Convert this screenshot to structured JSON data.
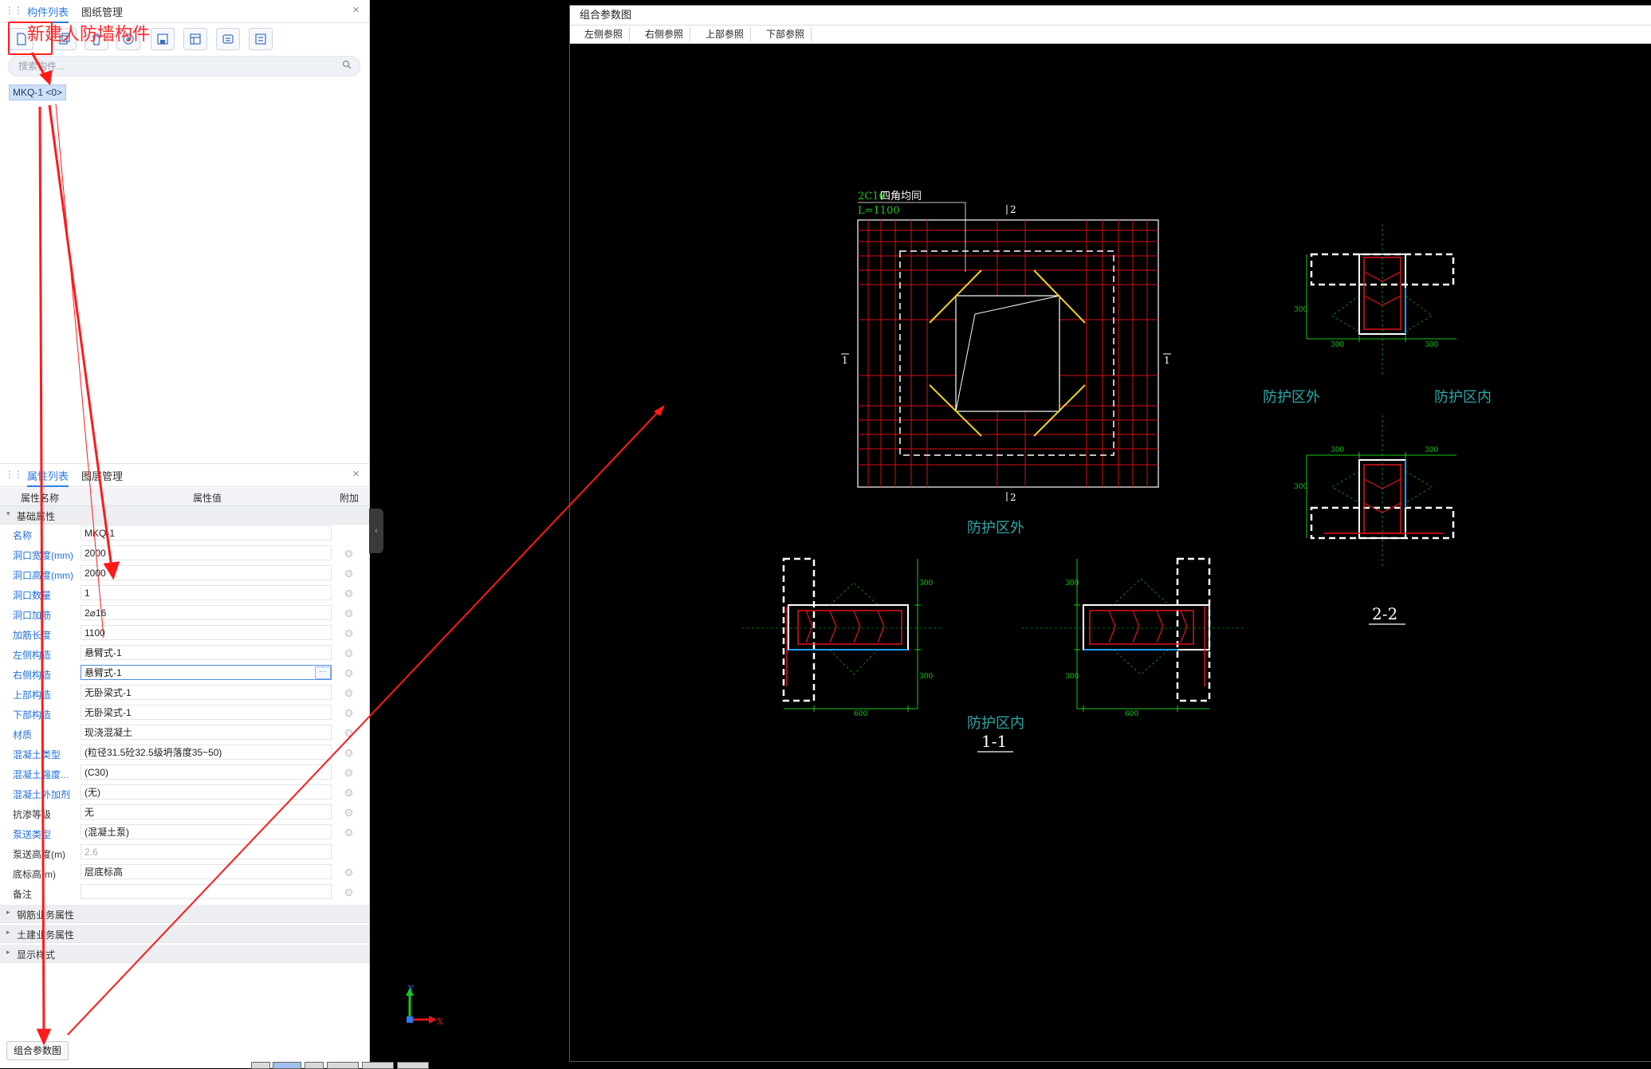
{
  "top_tabs": {
    "tab1": "构件列表",
    "tab2": "图纸管理",
    "close": "×"
  },
  "annotation": {
    "text": "新建人防墙构件"
  },
  "search": {
    "placeholder": "搜索构件..."
  },
  "tree": {
    "item": "MKQ-1 <0>"
  },
  "prop_tabs": {
    "tab1": "属性列表",
    "tab2": "图层管理",
    "close": "×"
  },
  "prop_header": {
    "name": "属性名称",
    "value": "属性值",
    "extra": "附加"
  },
  "groups": {
    "basic": "基础属性",
    "rebar": "钢筋业务属性",
    "civil": "土建业务属性",
    "display": "显示样式"
  },
  "properties": [
    {
      "name": "名称",
      "value": "MKQ-1",
      "blue": true
    },
    {
      "name": "洞口宽度(mm)",
      "value": "2000",
      "blue": true
    },
    {
      "name": "洞口高度(mm)",
      "value": "2000",
      "blue": true
    },
    {
      "name": "洞口数量",
      "value": "1",
      "blue": true
    },
    {
      "name": "洞口加筋",
      "value": "2⌀16",
      "blue": true
    },
    {
      "name": "加筋长度",
      "value": "1100",
      "blue": true
    },
    {
      "name": "左侧构造",
      "value": "悬臂式-1",
      "blue": true
    },
    {
      "name": "右侧构造",
      "value": "悬臂式-1",
      "blue": true
    },
    {
      "name": "上部构造",
      "value": "无卧梁式-1",
      "blue": true
    },
    {
      "name": "下部构造",
      "value": "无卧梁式-1",
      "blue": true
    },
    {
      "name": "材质",
      "value": "现浇混凝土",
      "blue": true
    },
    {
      "name": "混凝土类型",
      "value": "(粒径31.5砼32.5级坍落度35~50)",
      "blue": true
    },
    {
      "name": "混凝土强度...",
      "value": "(C30)",
      "blue": true
    },
    {
      "name": "混凝土外加剂",
      "value": "(无)",
      "blue": true
    },
    {
      "name": "抗渗等级",
      "value": "无",
      "blue": false
    },
    {
      "name": "泵送类型",
      "value": "(混凝土泵)",
      "blue": true
    },
    {
      "name": "泵送高度(m)",
      "value": "2.6",
      "blue": false
    },
    {
      "name": "底标高(m)",
      "value": "层底标高",
      "blue": false
    },
    {
      "name": "备注",
      "value": "",
      "blue": false
    }
  ],
  "bottom_button": "组合参数图",
  "window": {
    "title": "组合参数图",
    "tabs": [
      "左侧参照",
      "右侧参照",
      "上部参照",
      "下部参照"
    ]
  },
  "drawing": {
    "rebar_note": "2C16",
    "rebar_note2": "四角均同",
    "length_note": "L=1100",
    "sec2": "2",
    "sec1": "1",
    "plan_label": "防护区外",
    "section1_label_in": "防护区内",
    "section1_title": "1-1",
    "section2_out": "防护区外",
    "section2_in": "防护区内",
    "section2_title": "2-2",
    "dim_300": "300",
    "dim_600": "600",
    "axis_x": "X",
    "axis_y": "Y"
  },
  "colors": {
    "accent": "#2d7be5",
    "annotation_red": "#ff2020",
    "rebar_red": "#e0141e",
    "dim_green": "#19c819",
    "label_cyan": "#2aa7a7",
    "yellow": "#f0d020"
  }
}
